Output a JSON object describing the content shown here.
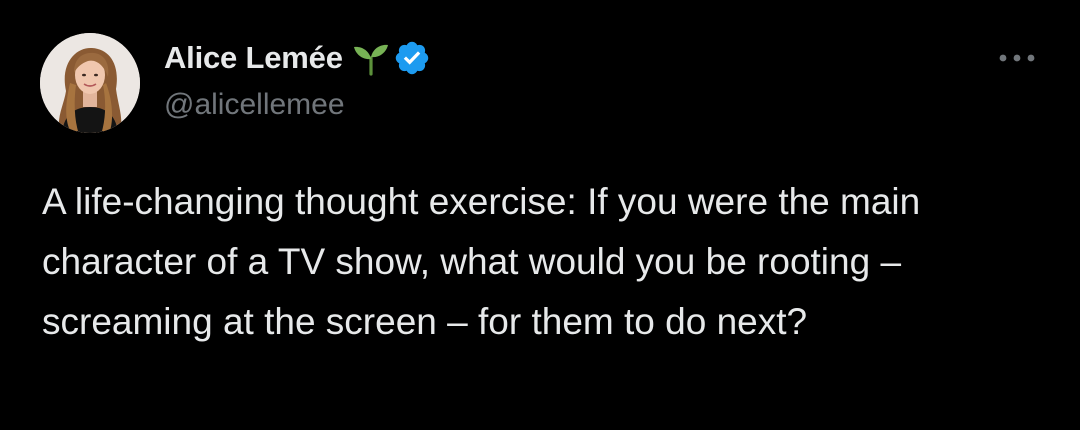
{
  "tweet": {
    "author": {
      "display_name": "Alice Lemée",
      "handle": "@alicellemee",
      "badge_emoji": "seedling-icon",
      "verified": true,
      "avatar": "avatar"
    },
    "text": "A life-changing thought exercise: If you were the main character of a TV show, what would you be rooting – screaming at the screen – for them to do next?",
    "more_menu": "more-options-icon"
  },
  "colors": {
    "background": "#000000",
    "text_primary": "#e7e9ea",
    "text_secondary": "#71767b",
    "verified_blue": "#1d9bf0",
    "sprout_green": "#77b255"
  }
}
